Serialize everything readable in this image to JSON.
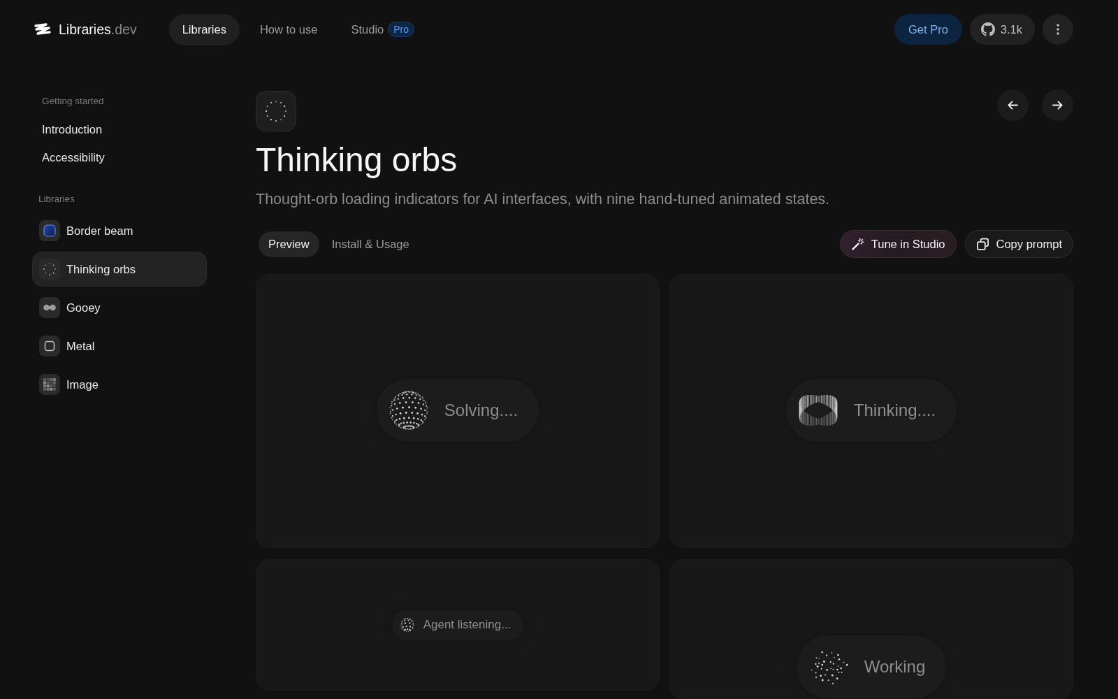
{
  "header": {
    "logo": {
      "name": "Libraries",
      "suffix": ".dev"
    },
    "nav": [
      {
        "label": "Libraries",
        "selected": true
      },
      {
        "label": "How to use",
        "selected": false
      },
      {
        "label": "Studio",
        "selected": false,
        "badge": "Pro"
      }
    ],
    "actions": [
      {
        "label": "Get Pro",
        "kind": "primary"
      },
      {
        "label": "3.1k",
        "kind": "github"
      },
      {
        "kind": "more"
      }
    ]
  },
  "sidebar": {
    "sections": [
      {
        "title": "Getting started",
        "items": [
          {
            "label": "Introduction",
            "selected": false
          },
          {
            "label": "Accessibility",
            "selected": false
          }
        ]
      },
      {
        "title": "Libraries",
        "items": [
          {
            "label": "Border beam",
            "kind": "beam",
            "selected": false
          },
          {
            "label": "Thinking orbs",
            "kind": "orbs",
            "selected": true
          },
          {
            "label": "Gooey",
            "kind": "gooey",
            "selected": false
          },
          {
            "label": "Metal",
            "kind": "metal",
            "selected": false
          },
          {
            "label": "Image",
            "kind": "image",
            "selected": false
          }
        ]
      }
    ]
  },
  "page": {
    "title": "Thinking orbs",
    "description": "Thought-orb loading indicators for AI interfaces, with nine hand-tuned animated states.",
    "tabs": [
      {
        "label": "Preview",
        "selected": true
      },
      {
        "label": "Install & Usage",
        "selected": false
      }
    ],
    "actions": [
      {
        "label": "Tune in Studio",
        "kind": "studio"
      },
      {
        "label": "Copy prompt",
        "kind": "copy"
      }
    ],
    "previews": [
      {
        "label": "Solving....",
        "kind": "sphere",
        "compact": false
      },
      {
        "label": "Thinking....",
        "kind": "ring",
        "compact": false
      },
      {
        "label": "Agent listening...",
        "kind": "sphere",
        "compact": true
      },
      {
        "label": "Working",
        "kind": "scatter",
        "compact": false
      }
    ]
  }
}
